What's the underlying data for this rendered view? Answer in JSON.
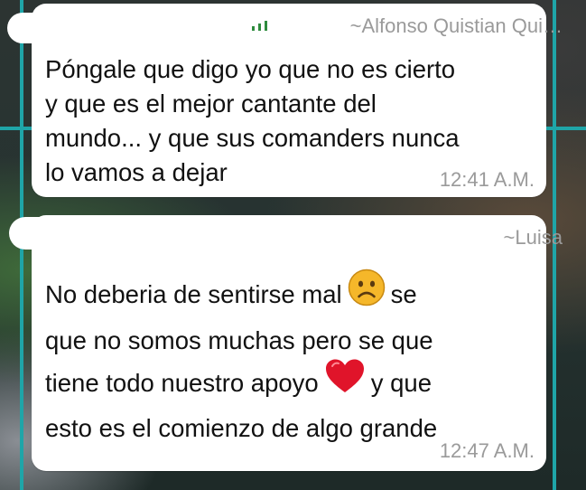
{
  "messages": [
    {
      "sender": "~Alfonso Quistian Qui…",
      "lines": [
        "Póngale que digo yo que no es cierto",
        "y que es el mejor cantante del",
        "mundo... y que sus comanders nunca",
        "lo vamos a dejar"
      ],
      "time": "12:41 A.M."
    },
    {
      "sender": "~Luisa",
      "line1_a": "No deberia de sentirse mal",
      "line1_b": "se",
      "line2": "que no somos muchas pero se que",
      "line3_a": "tiene todo nuestro apoyo",
      "line3_b": "y que",
      "line4": "esto es el comienzo de algo grande",
      "time": "12:47 A.M."
    }
  ],
  "icons": {
    "frown": "frowning-face-emoji",
    "heart": "red-heart-emoji"
  },
  "colors": {
    "bubble": "#ffffff",
    "text": "#111111",
    "meta": "#9a9a9a",
    "grid": "#1fa5a8",
    "heart": "#e0142a",
    "frown": "#f5b72a"
  }
}
